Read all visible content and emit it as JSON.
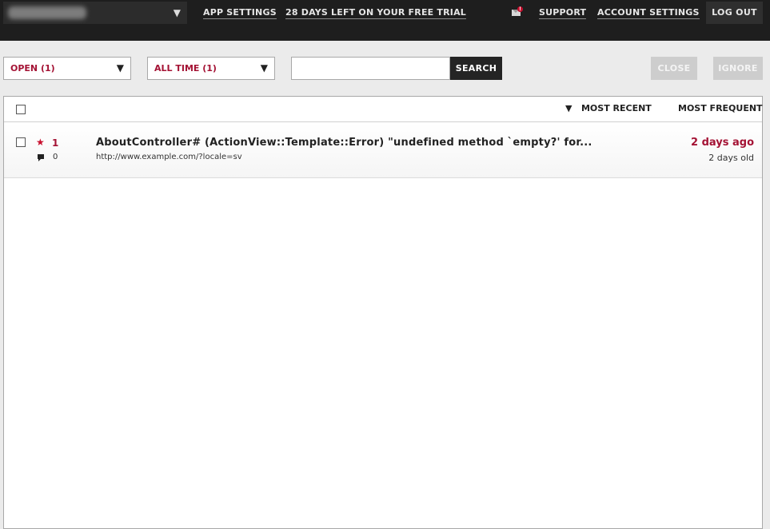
{
  "topbar": {
    "app_select_caret": "▼",
    "app_settings": "APP SETTINGS",
    "trial": "28 DAYS LEFT ON YOUR FREE TRIAL",
    "mail_badge": "!",
    "support": "SUPPORT",
    "account_settings": "ACCOUNT SETTINGS",
    "logout": "LOG OUT"
  },
  "filters": {
    "status": "OPEN (1)",
    "period": "ALL TIME (1)",
    "caret": "▼",
    "search_value": "",
    "search_button": "SEARCH",
    "close_button": "CLOSE",
    "ignore_button": "IGNORE"
  },
  "list_header": {
    "sort_indicator": "▼",
    "most_recent": "MOST RECENT",
    "most_frequent": "MOST FREQUENT"
  },
  "errors": [
    {
      "star": "★",
      "occurrences": "1",
      "comments": "0",
      "title": "AboutController# (ActionView::Template::Error) \"undefined method `empty?' for...",
      "url": "http://www.example.com/?locale=sv",
      "last_seen": "2 days ago",
      "age": "2 days old"
    }
  ],
  "colors": {
    "accent": "#a41234",
    "topbar": "#1e1e1e",
    "disabled_button": "#cdcdcd"
  }
}
